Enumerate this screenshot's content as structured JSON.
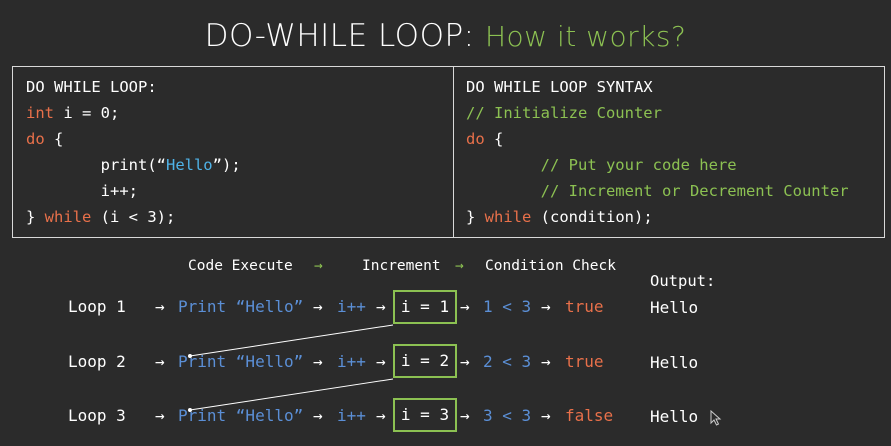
{
  "title": {
    "main": "DO-WHILE LOOP:",
    "sub": "How it works?"
  },
  "left_box": {
    "heading": "DO WHILE LOOP:",
    "line2_kw": "int",
    "line2_rest": " i = 0;",
    "line3_kw": "do",
    "line3_rest": " {",
    "line4_pre": "        print(“",
    "line4_str": "Hello",
    "line4_post": "”);",
    "line5": "        i++;",
    "line6_pre": "} ",
    "line6_kw": "while",
    "line6_post": " (i < 3);"
  },
  "right_box": {
    "heading": "DO WHILE LOOP SYNTAX",
    "line2": "// Initialize Counter",
    "line3_kw": "do",
    "line3_rest": " {",
    "line4": "        // Put your code here",
    "line5": "        // Increment or Decrement Counter",
    "line6_pre": "} ",
    "line6_kw": "while",
    "line6_post": " (condition);"
  },
  "header": {
    "code_execute": "Code Execute",
    "increment": "Increment",
    "condition_check": "Condition Check",
    "arrow": "→",
    "output": "Output:"
  },
  "rows": [
    {
      "label": "Loop 1",
      "print": "Print “Hello”",
      "inc": "i++",
      "i": "i = 1",
      "cond": "1 < 3",
      "result": "true",
      "output": "Hello"
    },
    {
      "label": "Loop 2",
      "print": "Print “Hello”",
      "inc": "i++",
      "i": "i = 2",
      "cond": "2 < 3",
      "result": "true",
      "output": "Hello"
    },
    {
      "label": "Loop 3",
      "print": "Print “Hello”",
      "inc": "i++",
      "i": "i = 3",
      "cond": "3 < 3",
      "result": "false",
      "output": "Hello"
    }
  ],
  "arrow": "→",
  "colors": {
    "background": "#2b2b2b",
    "keyword": "#e8704a",
    "string": "#4fb3e8",
    "comment": "#8cc152",
    "value": "#5b8fd6"
  }
}
